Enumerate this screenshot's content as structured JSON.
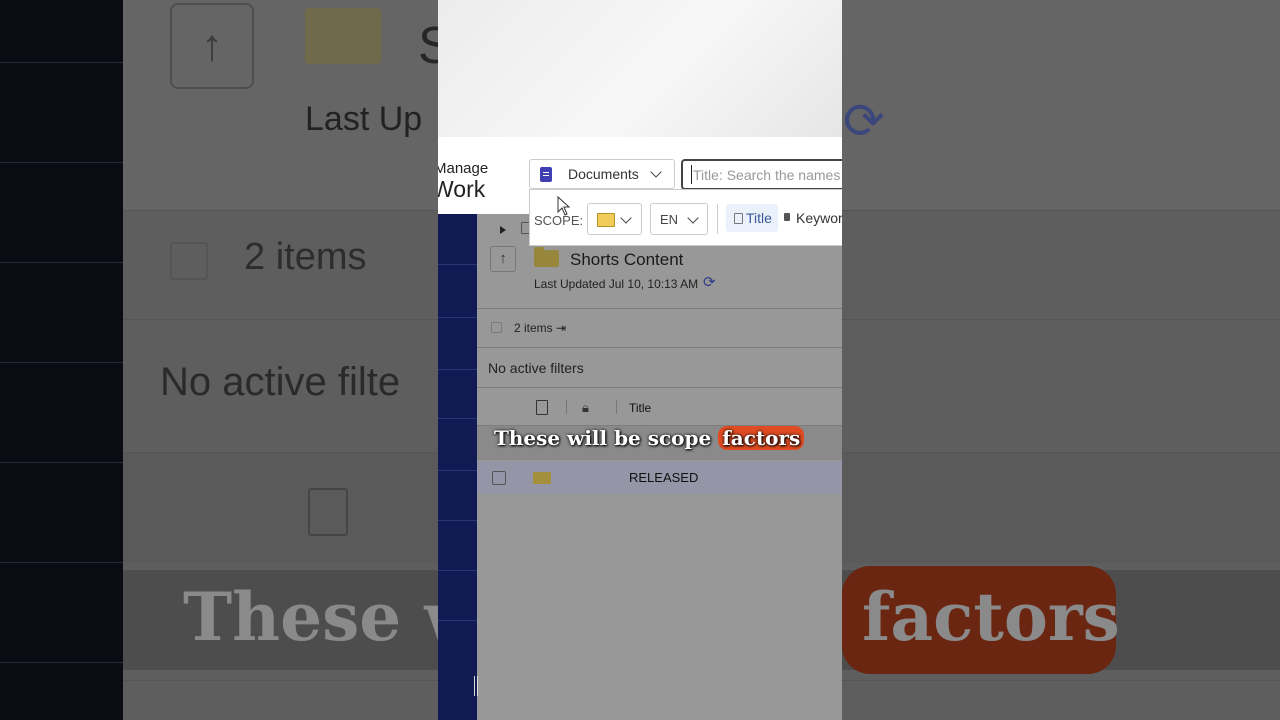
{
  "brand": {
    "line1": "Manage",
    "line2": "Work"
  },
  "search": {
    "type_label": "Documents",
    "placeholder": "Title: Search the names of",
    "scope_label": "SCOPE:",
    "language": "EN",
    "modes": [
      {
        "label": "Title",
        "active": true
      },
      {
        "label": "Keywords",
        "active": false
      }
    ]
  },
  "folder": {
    "title": "Shorts Content",
    "last_updated": "Last Updated Jul 10, 10:13 AM",
    "items_count": "2 items",
    "filters": "No active filters",
    "columns": [
      "Title"
    ],
    "rows": [
      {
        "title": "RELEASED"
      }
    ]
  },
  "caption": {
    "text": "These will be scope",
    "highlight": "factors"
  },
  "background": {
    "last_updated": "Last Up",
    "title_fragment": "S",
    "items_count": "2 items",
    "filters": "No active filte",
    "caption_left": "These w",
    "caption_right": "factors"
  },
  "colors": {
    "accent": "#3f3fb2",
    "nav": "#111a52",
    "caption_highlight": "#e04b22",
    "folder": "#f0cd5a"
  }
}
